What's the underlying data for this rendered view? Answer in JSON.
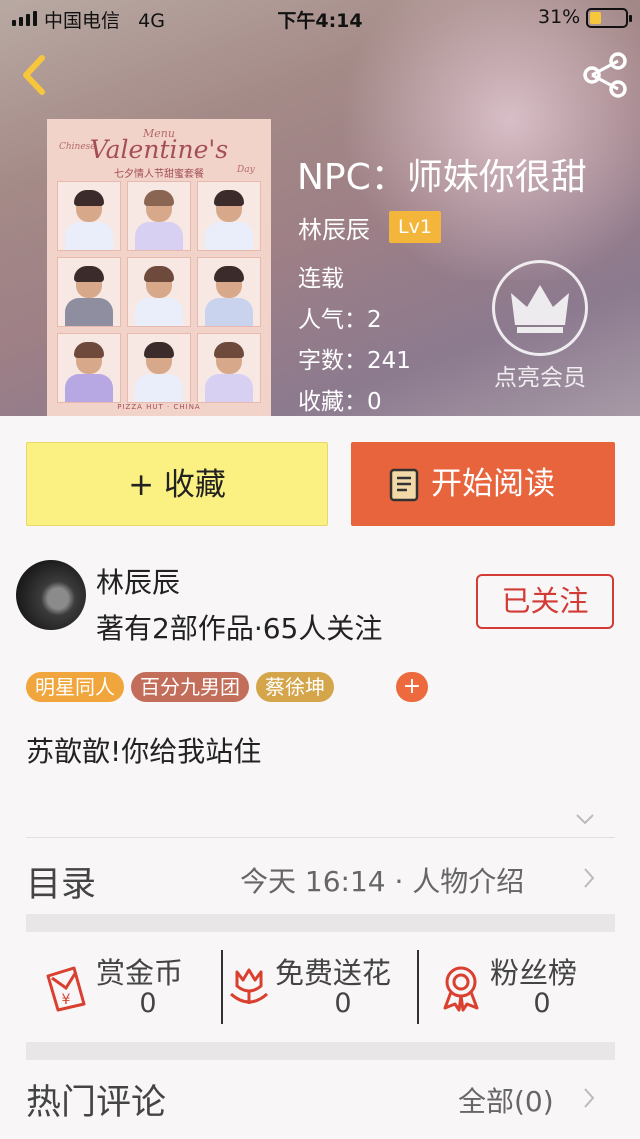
{
  "status_bar": {
    "carrier": "中国电信",
    "network": "4G",
    "time": "下午4:14",
    "battery_pct": "31%",
    "battery_level": 0.31,
    "battery_color": "#f6c63c"
  },
  "nav": {
    "back_icon": "chevron-left-icon",
    "share_icon": "share-icon",
    "accent_color": "#f6c63c"
  },
  "cover": {
    "menu": "Menu",
    "chinese": "Chinese",
    "title": "Valentine's",
    "day": "Day",
    "subtitle": "七夕情人节甜蜜套餐",
    "footer": "PIZZA HUT · CHINA"
  },
  "book": {
    "title": "NPC：师妹你很甜",
    "author": "林辰辰",
    "level": "Lv1",
    "status": "连载",
    "popularity": "人气：2",
    "word_count": "字数：241",
    "favorites": "收藏：0",
    "vip_label": "点亮会员",
    "vip_icon": "crown-icon"
  },
  "actions": {
    "collect_label": "+ 收藏",
    "read_label": "开始阅读",
    "read_icon": "book-icon"
  },
  "writer": {
    "name": "林辰辰",
    "stats": "著有2部作品·65人关注",
    "follow_label": "已关注"
  },
  "tags": [
    {
      "label": "明星同人",
      "color": "#f0a63c"
    },
    {
      "label": "百分九男团",
      "color": "#c26e5a"
    },
    {
      "label": "蔡徐坤",
      "color": "#d5a54b"
    }
  ],
  "tag_add": "+",
  "summary": "苏歆歆!你给我站住",
  "toc": {
    "label": "目录",
    "info": "今天 16:14 · 人物介绍"
  },
  "stats": [
    {
      "label": "赏金币",
      "value": "0",
      "icon": "red-envelope-icon"
    },
    {
      "label": "免费送花",
      "value": "0",
      "icon": "flower-icon"
    },
    {
      "label": "粉丝榜",
      "value": "0",
      "icon": "medal-icon"
    }
  ],
  "comments": {
    "label": "热门评论",
    "all_label": "全部(0)"
  },
  "colors": {
    "collect_bg": "#fbf082",
    "read_bg": "#e8643c",
    "follow_red": "#d33b35",
    "icon_red": "#d9402f"
  }
}
